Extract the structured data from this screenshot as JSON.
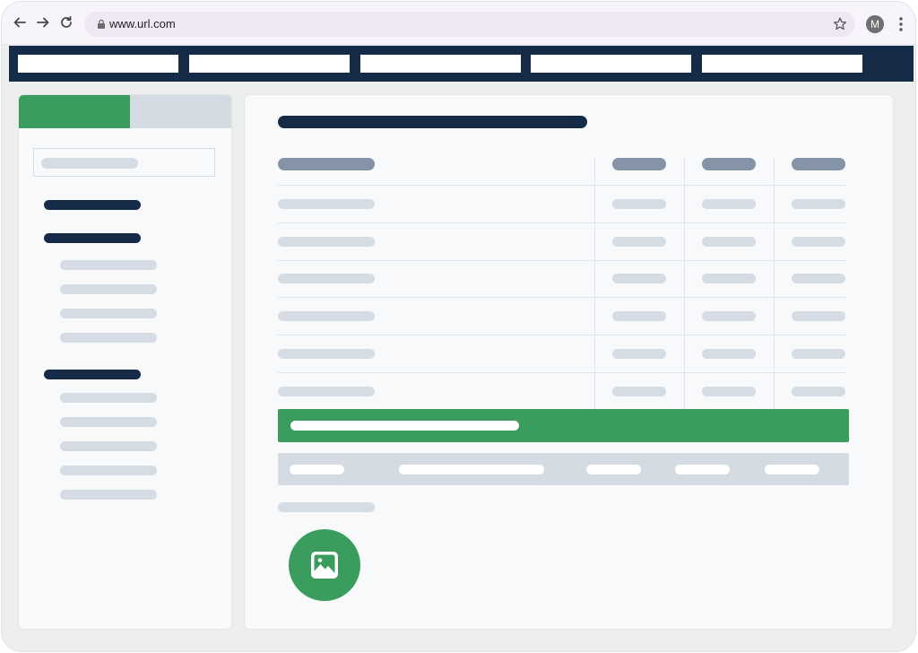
{
  "browser": {
    "url": "www.url.com",
    "avatar_initial": "M",
    "icons": [
      "back-arrow-icon",
      "forward-arrow-icon",
      "reload-icon",
      "lock-icon",
      "star-icon",
      "more-vert-icon"
    ]
  },
  "colors": {
    "nav_dark": "#152b47",
    "accent_green": "#3a9d5d",
    "placeholder_light": "#d5dce4",
    "placeholder_mid": "#8593a6"
  },
  "topnav": {
    "item_count": 5
  },
  "sidebar": {
    "section_count": 3
  },
  "table": {
    "row_count": 6,
    "numeric_columns": 3
  },
  "main": {
    "fab_icon": "image-icon"
  }
}
